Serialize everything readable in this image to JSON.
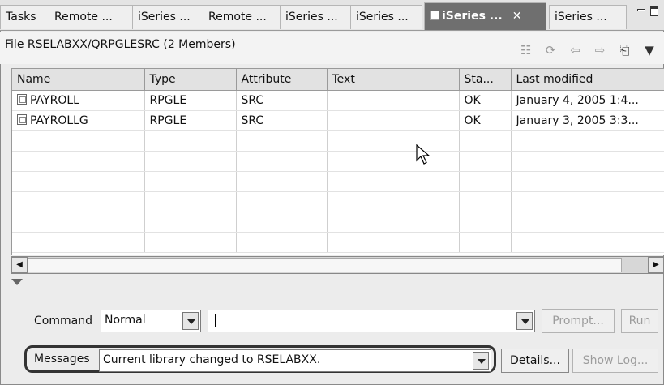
{
  "tabs": [
    {
      "label": "Tasks"
    },
    {
      "label": "Remote ..."
    },
    {
      "label": "iSeries ..."
    },
    {
      "label": "Remote ..."
    },
    {
      "label": "iSeries ..."
    },
    {
      "label": "iSeries ..."
    },
    {
      "label": "iSeries ...",
      "active": true
    },
    {
      "label": "iSeries ..."
    }
  ],
  "title": "File RSELABXX/QRPGLESRC (2 Members)",
  "table": {
    "columns": [
      "Name",
      "Type",
      "Attribute",
      "Text",
      "Sta...",
      "Last modified"
    ],
    "rows": [
      {
        "name": "PAYROLL",
        "type": "RPGLE",
        "attribute": "SRC",
        "text": "",
        "status": "OK",
        "modified": "January 4, 2005 1:4..."
      },
      {
        "name": "PAYROLLG",
        "type": "RPGLE",
        "attribute": "SRC",
        "text": "",
        "status": "OK",
        "modified": "January 3, 2005 3:3..."
      }
    ]
  },
  "command": {
    "label": "Command",
    "mode": "Normal",
    "input_value": "",
    "prompt_label": "Prompt...",
    "run_label": "Run"
  },
  "messages": {
    "label": "Messages",
    "value": "Current library changed to RSELABXX.",
    "details_label": "Details...",
    "showlog_label": "Show Log..."
  }
}
